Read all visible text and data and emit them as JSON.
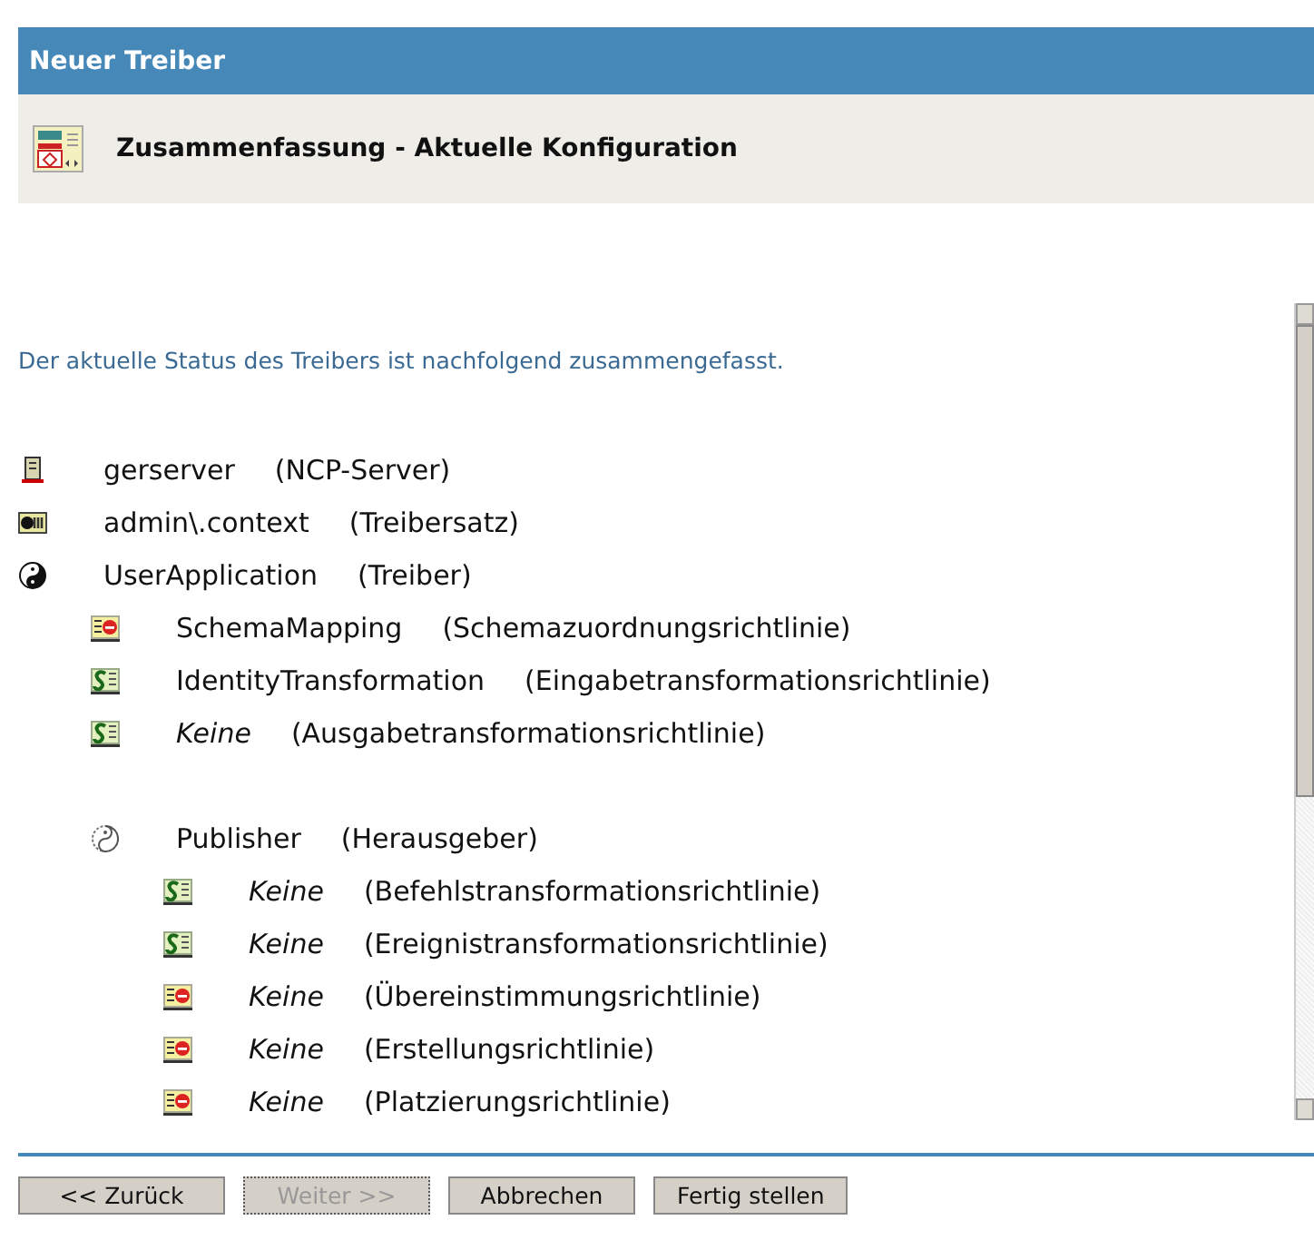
{
  "header": {
    "title": "Neuer Treiber"
  },
  "subheader": {
    "title": "Zusammenfassung - Aktuelle Konfiguration"
  },
  "intro": "Der aktuelle Status des Treibers ist nachfolgend zusammengefasst.",
  "tree": [
    {
      "kind": "server",
      "name": "gerserver",
      "type": "(NCP-Server)",
      "unset": false
    },
    {
      "kind": "driverset",
      "name": "admin\\.context",
      "type": "(Treibersatz)",
      "unset": false
    },
    {
      "kind": "driver",
      "name": "UserApplication",
      "type": "(Treiber)",
      "unset": false,
      "children": [
        {
          "kind": "policy",
          "name": "SchemaMapping",
          "type": "(Schemazuordnungsrichtlinie)",
          "unset": false
        },
        {
          "kind": "stylesheet",
          "name": "IdentityTransformation",
          "type": "(Eingabetransformationsrichtlinie)",
          "unset": false
        },
        {
          "kind": "stylesheet",
          "name": "Keine",
          "type": "(Ausgabetransformationsrichtlinie)",
          "unset": true
        },
        {
          "kind": "channel",
          "name": "Publisher",
          "type": "(Herausgeber)",
          "unset": false,
          "children": [
            {
              "kind": "stylesheet",
              "name": "Keine",
              "type": "(Befehlstransformationsrichtlinie)",
              "unset": true
            },
            {
              "kind": "stylesheet",
              "name": "Keine",
              "type": "(Ereignistransformationsrichtlinie)",
              "unset": true
            },
            {
              "kind": "policy",
              "name": "Keine",
              "type": "(Übereinstimmungsrichtlinie)",
              "unset": true
            },
            {
              "kind": "policy",
              "name": "Keine",
              "type": "(Erstellungsrichtlinie)",
              "unset": true
            },
            {
              "kind": "policy",
              "name": "Keine",
              "type": "(Platzierungsrichtlinie)",
              "unset": true
            }
          ]
        }
      ]
    }
  ],
  "buttons": [
    {
      "label": "<< Zurück",
      "disabled": false
    },
    {
      "label": "Weiter >>",
      "disabled": true
    },
    {
      "label": "Abbrechen",
      "disabled": false
    },
    {
      "label": "Fertig stellen",
      "disabled": false
    }
  ]
}
